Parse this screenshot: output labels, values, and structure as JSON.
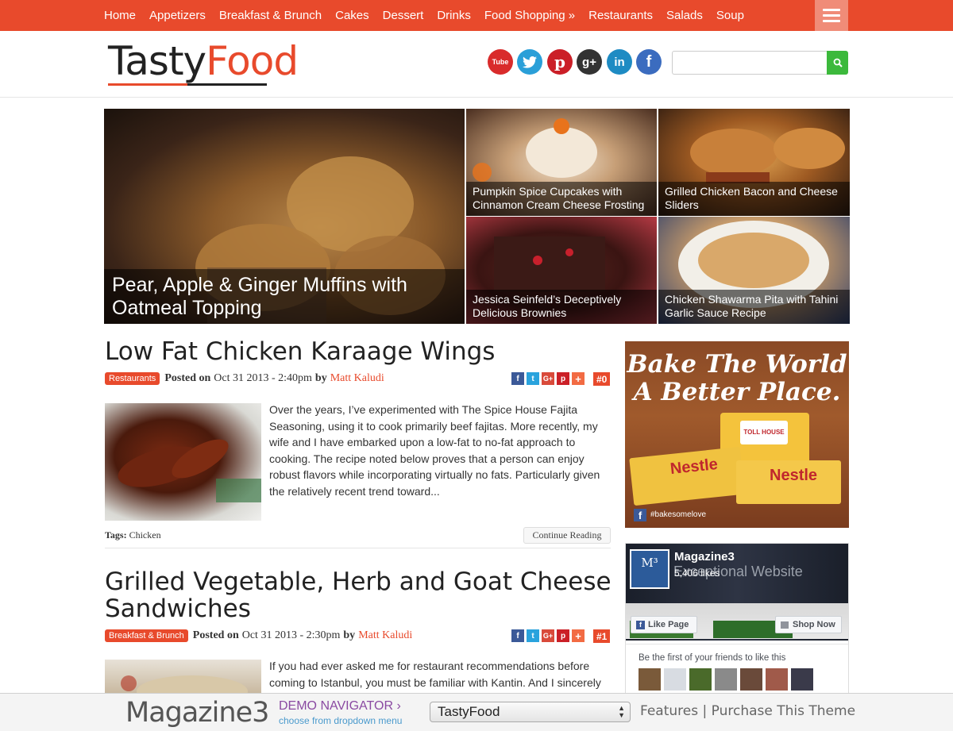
{
  "nav": {
    "items": [
      "Home",
      "Appetizers",
      "Breakfast & Brunch",
      "Cakes",
      "Dessert",
      "Drinks",
      "Food Shopping »",
      "Restaurants",
      "Salads",
      "Soup"
    ]
  },
  "header": {
    "logo_part1": "Tasty",
    "logo_part2": "Food",
    "search_placeholder": "",
    "social": [
      "youtube-icon",
      "twitter-icon",
      "pinterest-icon",
      "googleplus-icon",
      "linkedin-icon",
      "facebook-icon"
    ]
  },
  "featured": {
    "big": "Pear, Apple & Ginger Muffins with Oatmeal Topping",
    "small": [
      "Pumpkin Spice Cupcakes with Cinnamon Cream Cheese Frosting",
      "Grilled Chicken Bacon and Cheese Sliders",
      "Jessica Seinfeld’s Deceptively Delicious Brownies",
      "Chicken Shawarma Pita with Tahini Garlic Sauce Recipe"
    ]
  },
  "posts": [
    {
      "title": "Low Fat Chicken Karaage Wings",
      "category": "Restaurants",
      "posted_on_label": "Posted on",
      "date": "Oct 31 2013 - 2:40pm",
      "by_label": "by",
      "author": "Matt Kaludi",
      "count": "#0",
      "excerpt": "Over the years, I’ve experimented with The Spice House Fajita Seasoning, using it to cook primarily beef fajitas. More recently, my wife and I have embarked upon a low-fat to no-fat approach to cooking. The recipe noted below proves that a person can enjoy robust flavors while incorporating virtually no fats. Particularly given the relatively recent trend toward...",
      "tags_label": "Tags:",
      "tags": "Chicken",
      "continue": "Continue Reading"
    },
    {
      "title": "Grilled Vegetable, Herb and Goat Cheese Sandwiches",
      "category": "Breakfast & Brunch",
      "posted_on_label": "Posted on",
      "date": "Oct 31 2013 - 2:30pm",
      "by_label": "by",
      "author": "Matt Kaludi",
      "count": "#1",
      "excerpt": "If you had ever asked me for restaurant recommendations before coming to Istanbul, you must be familiar with Kantin. And I sincerely"
    }
  ],
  "sidebar": {
    "ad_line1": "Bake The World",
    "ad_line2": "A Better Place.",
    "ad_hashtag": "#bakesomelove",
    "ad_brand": "Nestle",
    "ad_tollhouse": "TOLL HOUSE",
    "fb_page": "Magazine3",
    "fb_likes": "5,406 likes",
    "fb_bg_text": "Exceptional Website",
    "fb_like": "Like Page",
    "fb_shop": "Shop Now",
    "fb_friends": "Be the first of your friends to like this"
  },
  "demobar": {
    "logo": "Magazine3",
    "title": "DEMO NAVIGATOR",
    "subtitle": "choose from dropdown menu",
    "selected": "TastyFood",
    "features": "Features",
    "separator": "|",
    "purchase": "Purchase This Theme"
  }
}
